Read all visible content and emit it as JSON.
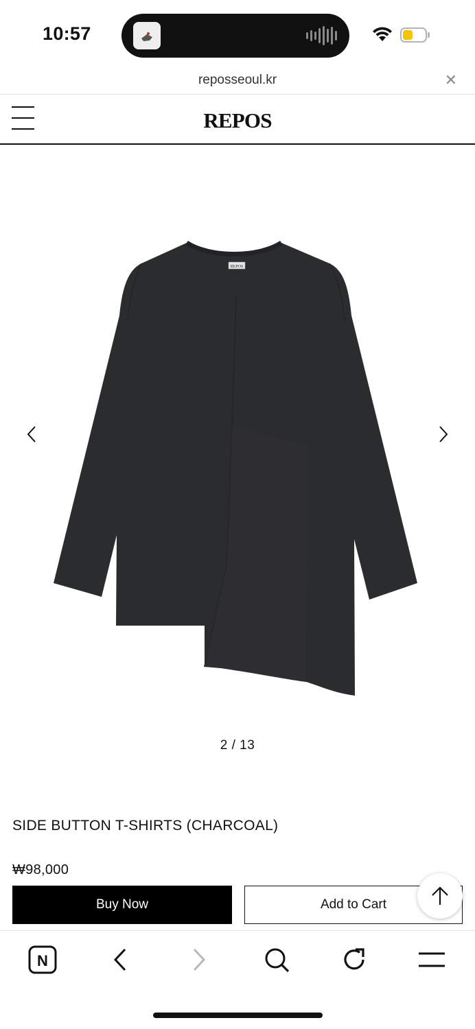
{
  "status_bar": {
    "time": "10:57",
    "island_thumbnail": "island-thumbnail",
    "audio_icon": "waveform-icon",
    "wifi_icon": "wifi-icon",
    "battery_icon": "battery-icon",
    "battery_level": 0.45,
    "battery_color": "#f5c400"
  },
  "browser": {
    "url": "reposseoul.kr",
    "close_icon": "close-icon",
    "close_glyph": "✕"
  },
  "site_header": {
    "menu_icon": "hamburger-menu-icon",
    "logo": "REPOS"
  },
  "gallery": {
    "prev_icon": "chevron-left-icon",
    "next_icon": "chevron-right-icon",
    "current": 2,
    "total": 13,
    "pager_text": "2 / 13",
    "image_subject": "charcoal long-sleeve t-shirt",
    "garment_color": "#2b2c2d",
    "label_text": "REPOS"
  },
  "product": {
    "name": "SIDE BUTTON T-SHIRTS (CHARCOAL)",
    "price": "₩98,000"
  },
  "actions": {
    "buy_now": "Buy Now",
    "add_to_cart": "Add to Cart",
    "scroll_top_icon": "arrow-up-icon"
  },
  "toolbar": {
    "items": [
      {
        "icon": "naver-home-icon",
        "glyph": "N"
      },
      {
        "icon": "back-icon"
      },
      {
        "icon": "forward-icon"
      },
      {
        "icon": "search-icon"
      },
      {
        "icon": "reload-icon"
      },
      {
        "icon": "menu-icon"
      }
    ]
  }
}
